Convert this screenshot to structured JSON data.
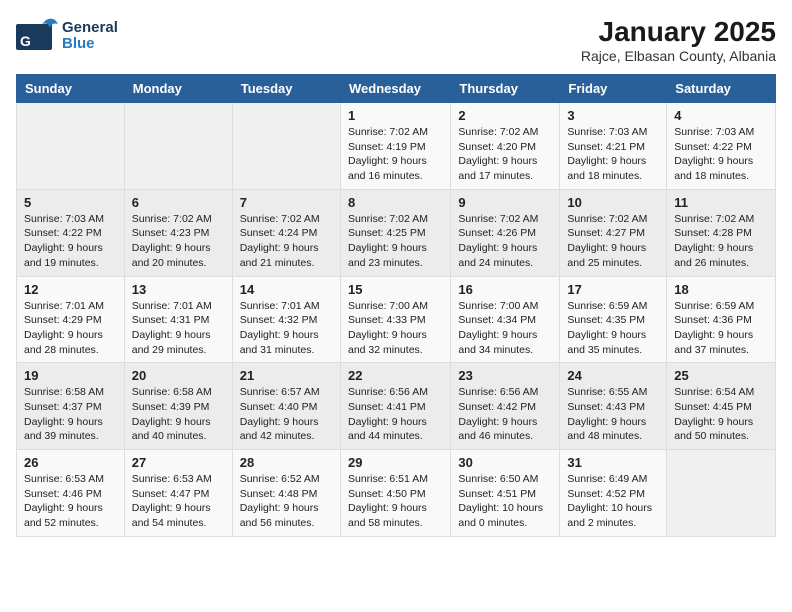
{
  "logo": {
    "general": "General",
    "blue": "Blue"
  },
  "title": "January 2025",
  "subtitle": "Rajce, Elbasan County, Albania",
  "days_header": [
    "Sunday",
    "Monday",
    "Tuesday",
    "Wednesday",
    "Thursday",
    "Friday",
    "Saturday"
  ],
  "weeks": [
    [
      {
        "day": "",
        "info": ""
      },
      {
        "day": "",
        "info": ""
      },
      {
        "day": "",
        "info": ""
      },
      {
        "day": "1",
        "info": "Sunrise: 7:02 AM\nSunset: 4:19 PM\nDaylight: 9 hours and 16 minutes."
      },
      {
        "day": "2",
        "info": "Sunrise: 7:02 AM\nSunset: 4:20 PM\nDaylight: 9 hours and 17 minutes."
      },
      {
        "day": "3",
        "info": "Sunrise: 7:03 AM\nSunset: 4:21 PM\nDaylight: 9 hours and 18 minutes."
      },
      {
        "day": "4",
        "info": "Sunrise: 7:03 AM\nSunset: 4:22 PM\nDaylight: 9 hours and 18 minutes."
      }
    ],
    [
      {
        "day": "5",
        "info": "Sunrise: 7:03 AM\nSunset: 4:22 PM\nDaylight: 9 hours and 19 minutes."
      },
      {
        "day": "6",
        "info": "Sunrise: 7:02 AM\nSunset: 4:23 PM\nDaylight: 9 hours and 20 minutes."
      },
      {
        "day": "7",
        "info": "Sunrise: 7:02 AM\nSunset: 4:24 PM\nDaylight: 9 hours and 21 minutes."
      },
      {
        "day": "8",
        "info": "Sunrise: 7:02 AM\nSunset: 4:25 PM\nDaylight: 9 hours and 23 minutes."
      },
      {
        "day": "9",
        "info": "Sunrise: 7:02 AM\nSunset: 4:26 PM\nDaylight: 9 hours and 24 minutes."
      },
      {
        "day": "10",
        "info": "Sunrise: 7:02 AM\nSunset: 4:27 PM\nDaylight: 9 hours and 25 minutes."
      },
      {
        "day": "11",
        "info": "Sunrise: 7:02 AM\nSunset: 4:28 PM\nDaylight: 9 hours and 26 minutes."
      }
    ],
    [
      {
        "day": "12",
        "info": "Sunrise: 7:01 AM\nSunset: 4:29 PM\nDaylight: 9 hours and 28 minutes."
      },
      {
        "day": "13",
        "info": "Sunrise: 7:01 AM\nSunset: 4:31 PM\nDaylight: 9 hours and 29 minutes."
      },
      {
        "day": "14",
        "info": "Sunrise: 7:01 AM\nSunset: 4:32 PM\nDaylight: 9 hours and 31 minutes."
      },
      {
        "day": "15",
        "info": "Sunrise: 7:00 AM\nSunset: 4:33 PM\nDaylight: 9 hours and 32 minutes."
      },
      {
        "day": "16",
        "info": "Sunrise: 7:00 AM\nSunset: 4:34 PM\nDaylight: 9 hours and 34 minutes."
      },
      {
        "day": "17",
        "info": "Sunrise: 6:59 AM\nSunset: 4:35 PM\nDaylight: 9 hours and 35 minutes."
      },
      {
        "day": "18",
        "info": "Sunrise: 6:59 AM\nSunset: 4:36 PM\nDaylight: 9 hours and 37 minutes."
      }
    ],
    [
      {
        "day": "19",
        "info": "Sunrise: 6:58 AM\nSunset: 4:37 PM\nDaylight: 9 hours and 39 minutes."
      },
      {
        "day": "20",
        "info": "Sunrise: 6:58 AM\nSunset: 4:39 PM\nDaylight: 9 hours and 40 minutes."
      },
      {
        "day": "21",
        "info": "Sunrise: 6:57 AM\nSunset: 4:40 PM\nDaylight: 9 hours and 42 minutes."
      },
      {
        "day": "22",
        "info": "Sunrise: 6:56 AM\nSunset: 4:41 PM\nDaylight: 9 hours and 44 minutes."
      },
      {
        "day": "23",
        "info": "Sunrise: 6:56 AM\nSunset: 4:42 PM\nDaylight: 9 hours and 46 minutes."
      },
      {
        "day": "24",
        "info": "Sunrise: 6:55 AM\nSunset: 4:43 PM\nDaylight: 9 hours and 48 minutes."
      },
      {
        "day": "25",
        "info": "Sunrise: 6:54 AM\nSunset: 4:45 PM\nDaylight: 9 hours and 50 minutes."
      }
    ],
    [
      {
        "day": "26",
        "info": "Sunrise: 6:53 AM\nSunset: 4:46 PM\nDaylight: 9 hours and 52 minutes."
      },
      {
        "day": "27",
        "info": "Sunrise: 6:53 AM\nSunset: 4:47 PM\nDaylight: 9 hours and 54 minutes."
      },
      {
        "day": "28",
        "info": "Sunrise: 6:52 AM\nSunset: 4:48 PM\nDaylight: 9 hours and 56 minutes."
      },
      {
        "day": "29",
        "info": "Sunrise: 6:51 AM\nSunset: 4:50 PM\nDaylight: 9 hours and 58 minutes."
      },
      {
        "day": "30",
        "info": "Sunrise: 6:50 AM\nSunset: 4:51 PM\nDaylight: 10 hours and 0 minutes."
      },
      {
        "day": "31",
        "info": "Sunrise: 6:49 AM\nSunset: 4:52 PM\nDaylight: 10 hours and 2 minutes."
      },
      {
        "day": "",
        "info": ""
      }
    ]
  ]
}
